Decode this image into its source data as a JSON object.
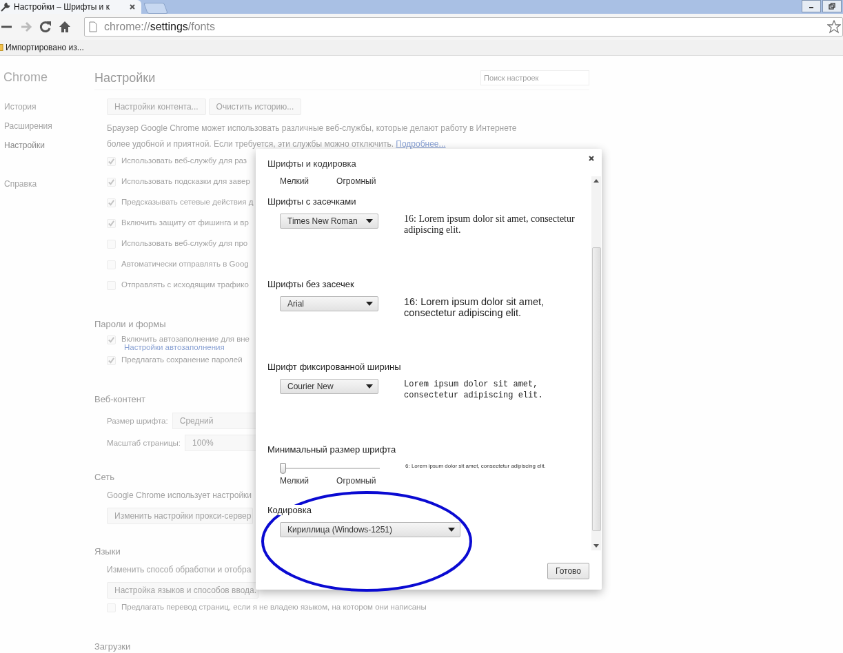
{
  "browser": {
    "tab": {
      "title": "Настройки – Шрифты и к",
      "selected": true
    },
    "nav": {
      "forward_disabled": true
    },
    "address": {
      "scheme": "chrome://",
      "host": "settings",
      "path": "/fonts"
    },
    "bookmarks": [
      {
        "label": "Импортировано из..."
      }
    ]
  },
  "sidebar": {
    "title": "Chrome",
    "items": [
      {
        "label": "История",
        "selected": false
      },
      {
        "label": "Расширения",
        "selected": false
      },
      {
        "label": "Настройки",
        "selected": true
      },
      {
        "label": "Справка",
        "selected": false
      }
    ]
  },
  "settings": {
    "title": "Настройки",
    "search": {
      "placeholder": "Поиск настроек"
    },
    "sections": [
      {
        "items": [
          {
            "kind": "buttons",
            "buttons": [
              "Настройки контента...",
              "Очистить историю..."
            ]
          },
          {
            "kind": "paragraph",
            "lines": [
              "Браузер Google Chrome может использовать различные веб-службы, которые делают работу в Интернете",
              "более удобной и приятной. Если требуется, эти службы можно отключить."
            ],
            "link": "Подробнее..."
          },
          {
            "kind": "checkbox",
            "label": "Использовать веб-службу для раз",
            "checked": true
          },
          {
            "kind": "checkbox",
            "label": "Использовать подсказки для завер",
            "checked": true
          },
          {
            "kind": "checkbox",
            "label": "Предсказывать сетевые действия д",
            "checked": true
          },
          {
            "kind": "checkbox",
            "label": "Включить защиту от фишинга и вр",
            "checked": true
          },
          {
            "kind": "checkbox",
            "label": "Использовать веб-службу для про",
            "checked": false
          },
          {
            "kind": "checkbox",
            "label": "Автоматически отправлять в Goog",
            "checked": false
          },
          {
            "kind": "checkbox",
            "label": "Отправлять с исходящим трафико",
            "checked": false
          }
        ]
      },
      {
        "heading": "Пароли и формы",
        "items": [
          {
            "kind": "checkbox",
            "label": "Включить автозаполнение для вне",
            "checked": true,
            "link": "Настройки автозаполнения"
          },
          {
            "kind": "checkbox",
            "label": "Предлагать сохранение паролей",
            "checked": true
          }
        ]
      },
      {
        "heading": "Веб-контент",
        "items": [
          {
            "kind": "select",
            "label": "Размер шрифта:",
            "value": "Средний"
          },
          {
            "kind": "select",
            "label": "Масштаб страницы:",
            "value": "100%"
          }
        ]
      },
      {
        "heading": "Сеть",
        "items": [
          {
            "kind": "text",
            "text": "Google Chrome использует настройки"
          },
          {
            "kind": "button",
            "label": "Изменить настройки прокси-сервер"
          }
        ]
      },
      {
        "heading": "Языки",
        "items": [
          {
            "kind": "text",
            "text": "Изменить способ обработки и отобра"
          },
          {
            "kind": "button",
            "label": "Настройка языков и способов ввода."
          },
          {
            "kind": "checkbox",
            "label": "Предлагать перевод страниц, если я не владею языком, на котором они написаны",
            "checked": false
          }
        ]
      },
      {
        "heading": "Загрузки"
      }
    ]
  },
  "dialog": {
    "title": "Шрифты и кодировка",
    "sections": [
      {
        "kind": "scale-labels",
        "min_label": "Мелкий",
        "max_label": "Огромный"
      },
      {
        "kind": "serif",
        "heading": "Шрифты с засечками",
        "select": "Times New Roman",
        "sample": "16: Lorem ipsum dolor sit amet, consectetur adipiscing elit."
      },
      {
        "kind": "sans",
        "heading": "Шрифты без засечек",
        "select": "Arial",
        "sample": "16: Lorem ipsum dolor sit amet, consectetur adipiscing elit."
      },
      {
        "kind": "mono",
        "heading": "Шрифт фиксированной ширины",
        "select": "Courier New",
        "sample": "Lorem ipsum dolor sit amet, consectetur adipiscing elit."
      },
      {
        "kind": "slider",
        "heading": "Минимальный размер шрифта",
        "level": 0,
        "sample": "6: Lorem ipsum dolor sit amet, consectetur adipiscing elit.",
        "min_label": "Мелкий",
        "max_label": "Огромный"
      },
      {
        "kind": "select",
        "heading": "Кодировка",
        "select": "Кириллица (Windows-1251)"
      }
    ],
    "button": "Готово"
  }
}
